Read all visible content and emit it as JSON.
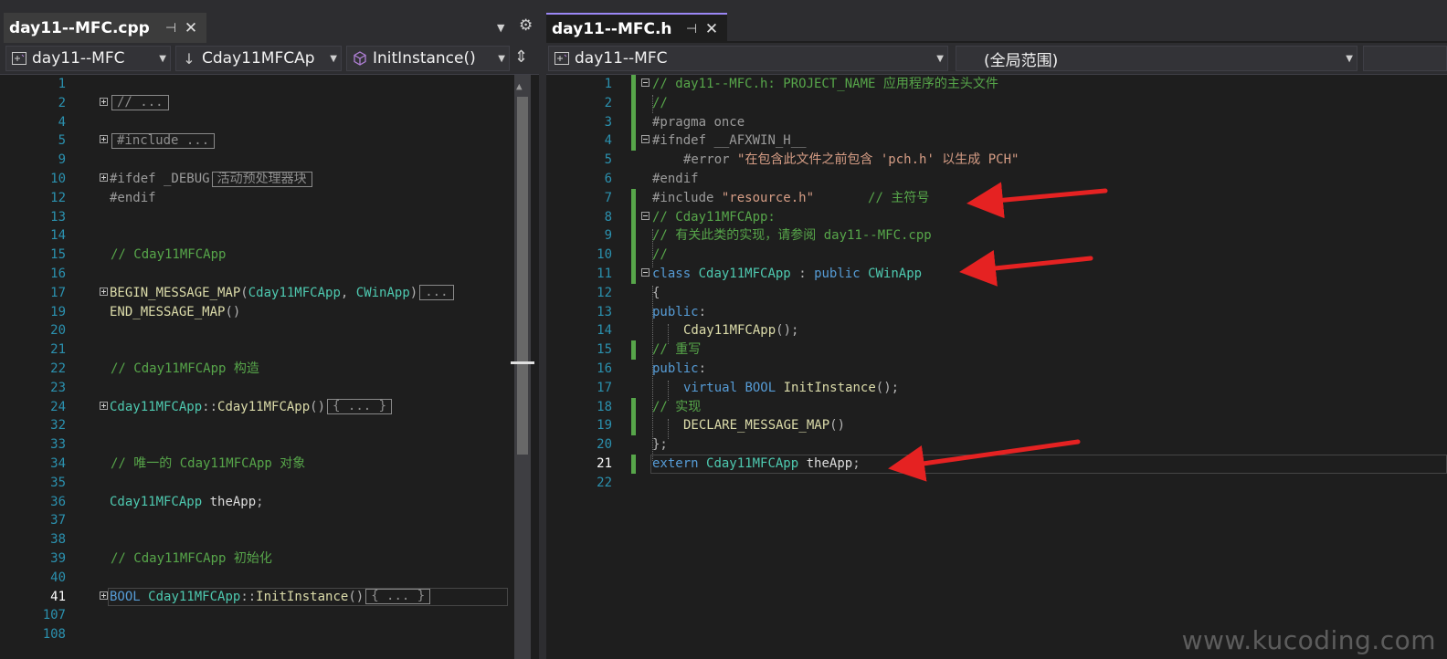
{
  "colors": {
    "editor_bg": "#1e1e1e",
    "comment": "#57a64a",
    "keyword": "#569cd6",
    "class_name": "#4ec9b0",
    "function_name": "#dcdcaa",
    "string": "#d69d85",
    "preprocessor": "#9b9b9b",
    "line_number": "#2b91af",
    "change_bar": "#57a64a",
    "active_tab_accent": "#9b87f5",
    "annotation_arrow": "#e52222"
  },
  "left": {
    "tab": {
      "title": "day11--MFC.cpp",
      "pin_icon": "pin-icon",
      "close_icon": "close-icon"
    },
    "tabstrip_dropdown_icon": "dropdown-icon",
    "tabstrip_settings_icon": "gear-icon",
    "nav": {
      "project": "day11--MFC",
      "class": "Cday11MFCAp",
      "member": "InitInstance()",
      "split_icon": "split-icon"
    },
    "lines": [
      {
        "n": "1"
      },
      {
        "n": "2",
        "collapsed": "// ..."
      },
      {
        "n": "4"
      },
      {
        "n": "5",
        "collapsed": "#include ..."
      },
      {
        "n": "9"
      },
      {
        "n": "10",
        "code": "#ifdef _DEBUG",
        "collapsed": "活动预处理器块"
      },
      {
        "n": "12",
        "code": "#endif"
      },
      {
        "n": "13"
      },
      {
        "n": "14"
      },
      {
        "n": "15",
        "comment": "// Cday11MFCApp"
      },
      {
        "n": "16"
      },
      {
        "n": "17",
        "code": "BEGIN_MESSAGE_MAP(Cday11MFCApp, CWinApp)",
        "collapsed": "..."
      },
      {
        "n": "19",
        "code": "END_MESSAGE_MAP()"
      },
      {
        "n": "20"
      },
      {
        "n": "21"
      },
      {
        "n": "22",
        "comment": "// Cday11MFCApp 构造"
      },
      {
        "n": "23"
      },
      {
        "n": "24",
        "code": "Cday11MFCApp::Cday11MFCApp()",
        "collapsed": "{ ... }"
      },
      {
        "n": "32"
      },
      {
        "n": "33"
      },
      {
        "n": "34",
        "comment": "// 唯一的 Cday11MFCApp 对象"
      },
      {
        "n": "35"
      },
      {
        "n": "36",
        "code": "Cday11MFCApp theApp;"
      },
      {
        "n": "37"
      },
      {
        "n": "38"
      },
      {
        "n": "39",
        "comment": "// Cday11MFCApp 初始化"
      },
      {
        "n": "40"
      },
      {
        "n": "41",
        "code": "BOOL Cday11MFCApp::InitInstance()",
        "collapsed": "{ ... }",
        "current": true
      },
      {
        "n": "107"
      },
      {
        "n": "108"
      }
    ]
  },
  "right": {
    "tab": {
      "title": "day11--MFC.h",
      "pin_icon": "pin-icon",
      "close_icon": "close-icon"
    },
    "nav": {
      "project": "day11--MFC",
      "scope": "(全局范围)"
    },
    "lines": [
      {
        "n": "1",
        "text": "// day11--MFC.h: PROJECT_NAME 应用程序的主头文件"
      },
      {
        "n": "2",
        "text": "//"
      },
      {
        "n": "3",
        "text": "#pragma once"
      },
      {
        "n": "4",
        "text": "#ifndef __AFXWIN_H__"
      },
      {
        "n": "5",
        "text": "#error \"在包含此文件之前包含 'pch.h' 以生成 PCH\""
      },
      {
        "n": "6",
        "text": "#endif"
      },
      {
        "n": "7",
        "text": "#include \"resource.h\"       // 主符号"
      },
      {
        "n": "8",
        "text": "// Cday11MFCApp:"
      },
      {
        "n": "9",
        "text": "// 有关此类的实现，请参阅 day11--MFC.cpp"
      },
      {
        "n": "10",
        "text": "//"
      },
      {
        "n": "11",
        "text": "class Cday11MFCApp : public CWinApp"
      },
      {
        "n": "12",
        "text": "{"
      },
      {
        "n": "13",
        "text": "public:"
      },
      {
        "n": "14",
        "text": "Cday11MFCApp();"
      },
      {
        "n": "15",
        "text": "// 重写"
      },
      {
        "n": "16",
        "text": "public:"
      },
      {
        "n": "17",
        "text": "virtual BOOL InitInstance();"
      },
      {
        "n": "18",
        "text": "// 实现"
      },
      {
        "n": "19",
        "text": "DECLARE_MESSAGE_MAP()"
      },
      {
        "n": "20",
        "text": "};"
      },
      {
        "n": "21",
        "text": "extern Cday11MFCApp theApp;",
        "current": true
      },
      {
        "n": "22",
        "text": ""
      }
    ]
  },
  "watermark": "www.kucoding.com"
}
